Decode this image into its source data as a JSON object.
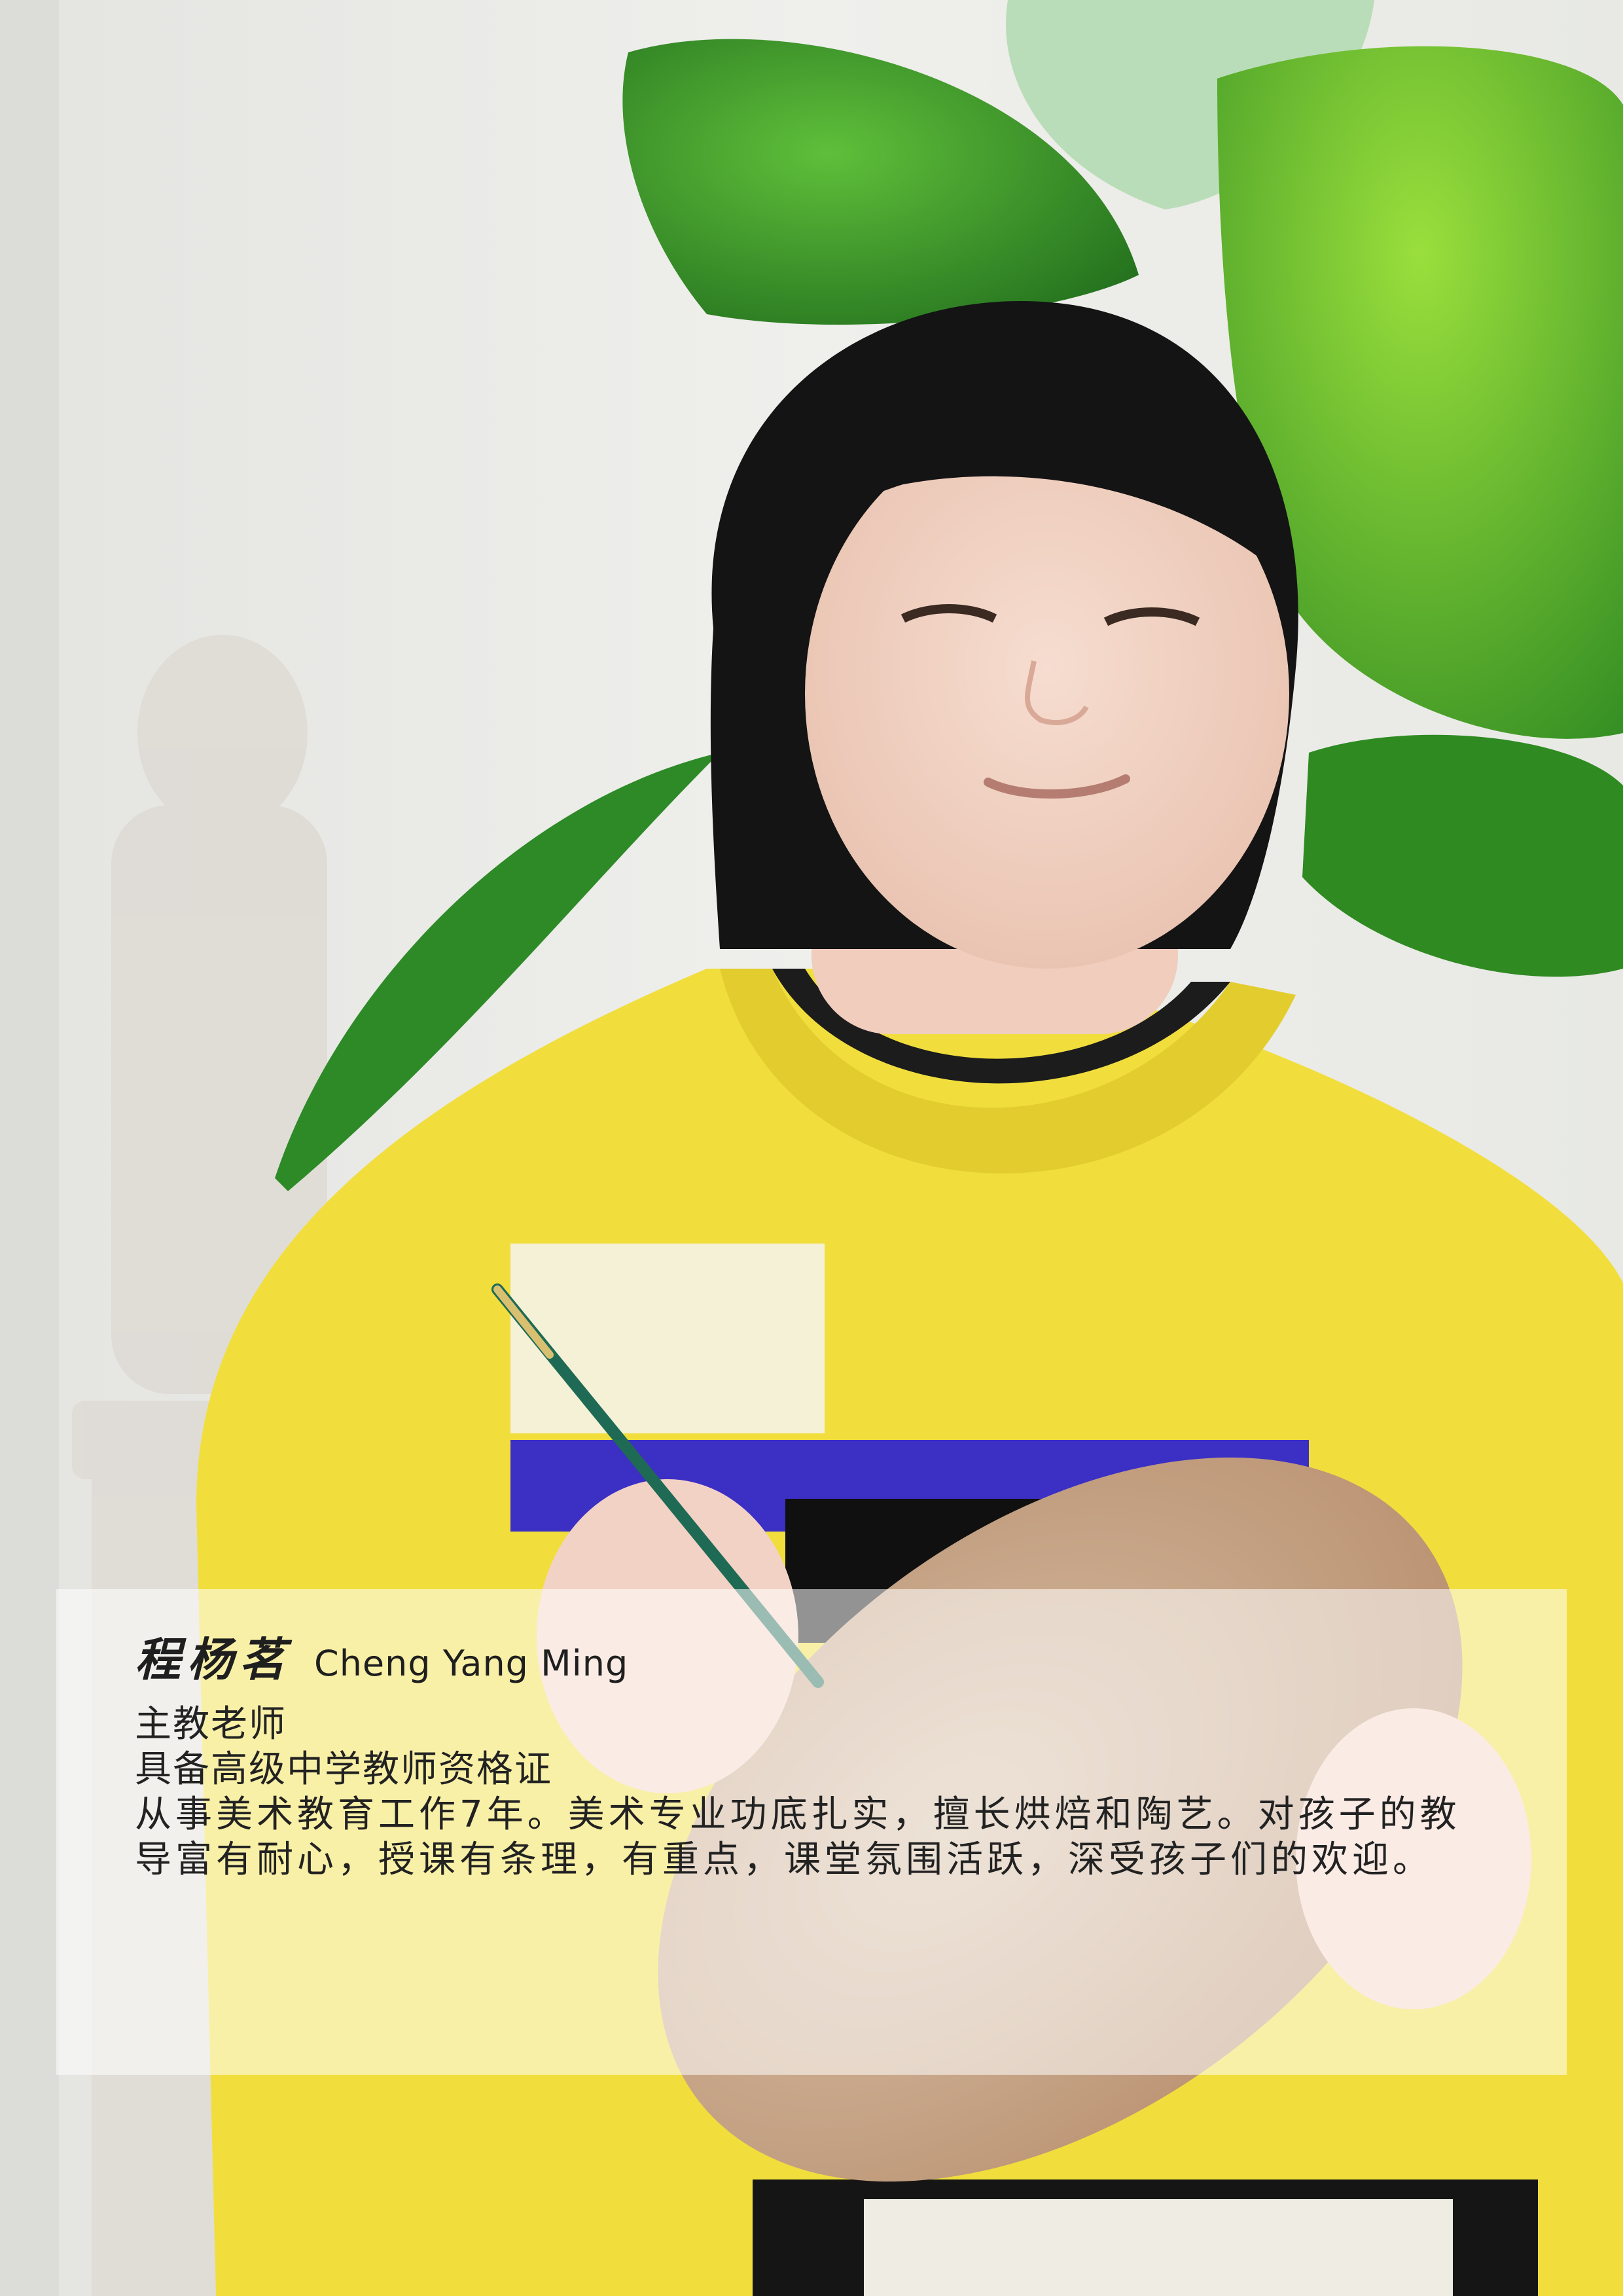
{
  "teacher": {
    "name_cn": "程杨茗",
    "name_en": "Cheng Yang Ming",
    "role": "主教老师",
    "qualification": "具备高级中学教师资格证",
    "bio": "从事美术教育工作7年。美术专业功底扎实，擅长烘焙和陶艺。对孩子的教导富有耐心，授课有条理，有重点，课堂氛围活跃，深受孩子们的欢迎。"
  },
  "colors": {
    "sweater": "#f0dd3a",
    "plant": "#3e8e2c",
    "palette": "#c9a88a",
    "background": "#ecece8"
  }
}
